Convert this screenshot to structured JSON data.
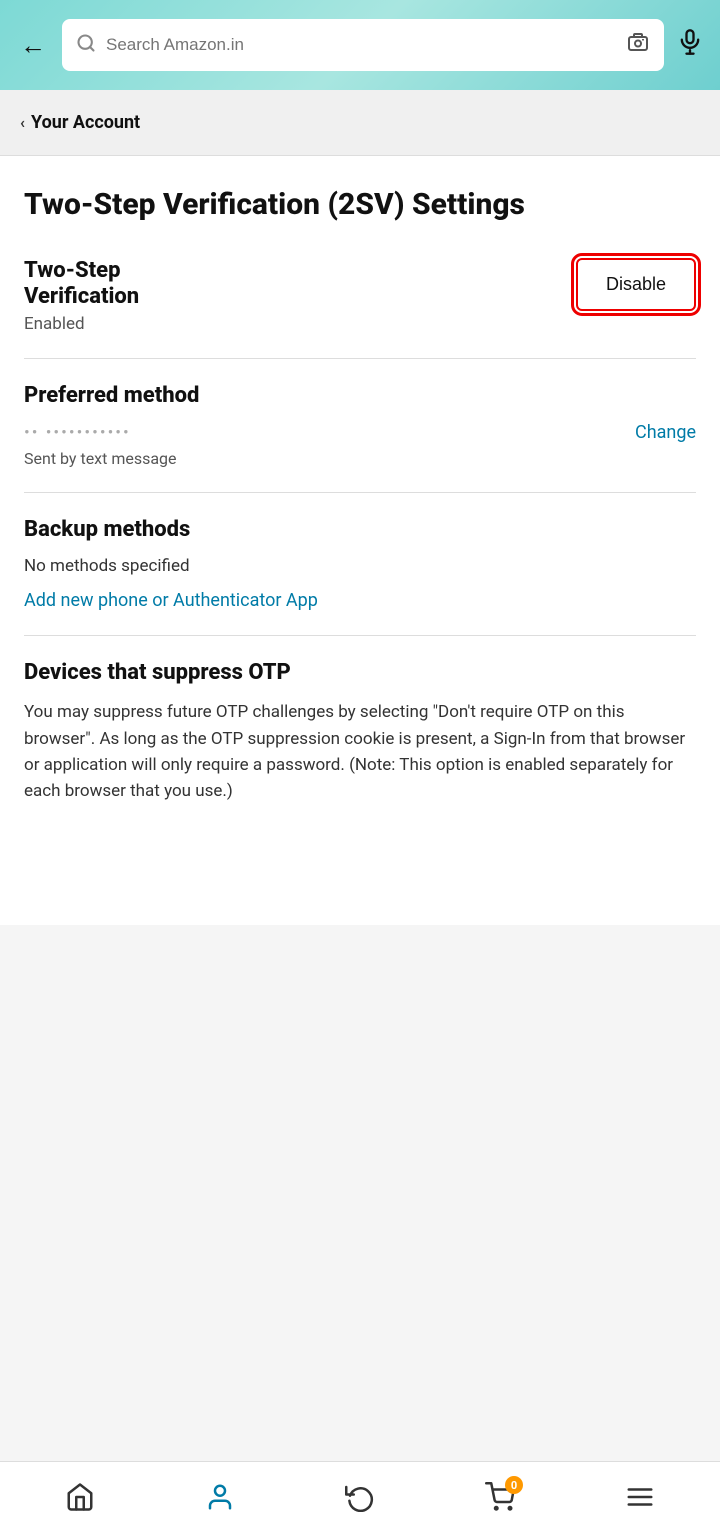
{
  "header": {
    "back_label": "←",
    "search_placeholder": "Search Amazon.in",
    "search_icon": "🔍",
    "camera_icon": "⊡",
    "mic_icon": "🎤"
  },
  "breadcrumb": {
    "chevron": "‹",
    "label": "Your Account"
  },
  "page": {
    "title": "Two-Step Verification (2SV) Settings"
  },
  "tsv_section": {
    "label_line1": "Two-Step",
    "label_line2": "Verification",
    "status": "Enabled",
    "disable_button": "Disable"
  },
  "preferred_method": {
    "section_title": "Preferred method",
    "phone_masked": "•• •••••••••••",
    "change_link": "Change",
    "description": "Sent by text message"
  },
  "backup_methods": {
    "section_title": "Backup methods",
    "no_methods": "No methods specified",
    "add_link": "Add new phone or Authenticator App"
  },
  "devices_section": {
    "title": "Devices that suppress OTP",
    "description": "You may suppress future OTP challenges by selecting \"Don't require OTP on this browser\". As long as the OTP suppression cookie is present, a Sign-In from that browser or application will only require a password. (Note: This option is enabled separately for each browser that you use.)"
  },
  "bottom_nav": {
    "home_icon": "🏠",
    "account_icon": "👤",
    "returns_icon": "↺",
    "cart_icon": "🛒",
    "cart_badge": "0",
    "menu_icon": "☰"
  },
  "colors": {
    "accent_teal": "#007ba7",
    "disable_red": "#cc0000",
    "header_gradient_start": "#7dd9d5",
    "header_gradient_end": "#6ecfcf"
  }
}
